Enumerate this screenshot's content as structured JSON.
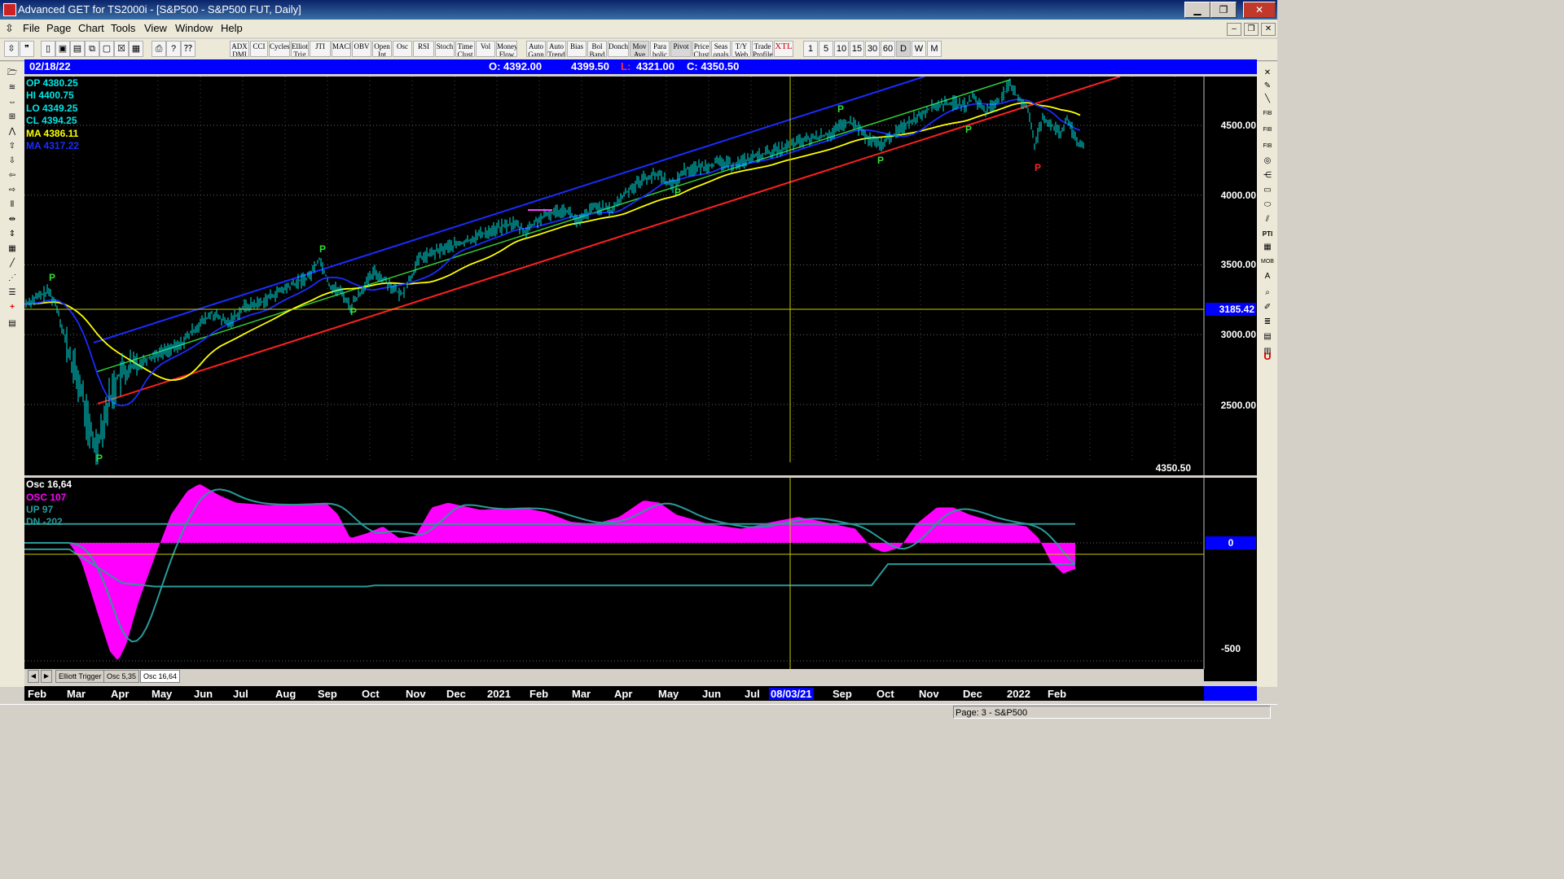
{
  "window": {
    "title": "Advanced GET for TS2000i - [S&P500 - S&P500 FUT, Daily]",
    "min_label": "▁",
    "max_label": "❐",
    "close_label": "✕"
  },
  "menu": {
    "items": [
      "File",
      "Page",
      "Chart",
      "Tools",
      "View",
      "Window",
      "Help"
    ],
    "mdi_min": "–",
    "mdi_restore": "❐",
    "mdi_close": "✕"
  },
  "toolbar": {
    "buttons": [
      "ADX DMI",
      "CCI",
      "Cycles",
      "Elliott Trig",
      "JTI",
      "MACD",
      "OBV",
      "Open Int",
      "Osc",
      "RSI",
      "Stoch",
      "Time Clust",
      "Vol",
      "Money Flow",
      "Auto Gann",
      "Auto Trend",
      "Bias",
      "Bol Band",
      "Donch",
      "Mov Ave",
      "Para bolic",
      "Pivot",
      "Price Clust",
      "Seas onals",
      "T/Y Web",
      "Trade Profile",
      "XTL"
    ],
    "timeframes": [
      "1",
      "5",
      "10",
      "15",
      "30",
      "60",
      "D",
      "W",
      "M"
    ]
  },
  "infobar": {
    "date": "02/18/22",
    "open": "O: 4392.00",
    "high": "4399.50",
    "low_prefix": "L:",
    "low": "4321.00",
    "close": "C: 4350.50"
  },
  "readout": {
    "op": "OP  4380.25",
    "hi": "HI   4400.75",
    "lo": "LO  4349.25",
    "cl": "CL  4394.25",
    "ma1": "MA  4386.11",
    "ma2": "MA  4317.22"
  },
  "price_axis": {
    "labels": [
      "4500.00",
      "4000.00",
      "3500.00",
      "3000.00",
      "2500.00"
    ],
    "crosshair_price": "3185.42",
    "last_price": "4350.50"
  },
  "pivot_markers": {
    "label": "P"
  },
  "oscillator": {
    "title": "Osc 16,64",
    "osc": "OSC 107",
    "up": "UP   97",
    "dn": "DN   -202",
    "axis_labels": [
      "0",
      "-500"
    ]
  },
  "tabs": [
    "Elliott Trigger",
    "Osc 5,35",
    "Osc 16,64"
  ],
  "time_axis": {
    "months": [
      "Feb",
      "Mar",
      "Apr",
      "May",
      "Jun",
      "Jul",
      "Aug",
      "Sep",
      "Oct",
      "Nov",
      "Dec",
      "2021",
      "Feb",
      "Mar",
      "Apr",
      "May",
      "Jun",
      "Jul",
      "08/03/21",
      "Sep",
      "Oct",
      "Nov",
      "Dec",
      "2022",
      "Feb"
    ]
  },
  "status": {
    "page": "Page: 3 - S&P500"
  },
  "colors": {
    "price_bars": "#00e5e5",
    "ma_fast": "#ffff00",
    "ma_slow": "#1a2cff",
    "channel_upper": "#1a2cff",
    "channel_lower": "#ff2020",
    "trend_mid": "#33cc33",
    "osc_fill": "#ff00ff",
    "osc_bands": "#2a9a9a",
    "pivot_green": "#33dd33",
    "pivot_red": "#ff2020"
  }
}
